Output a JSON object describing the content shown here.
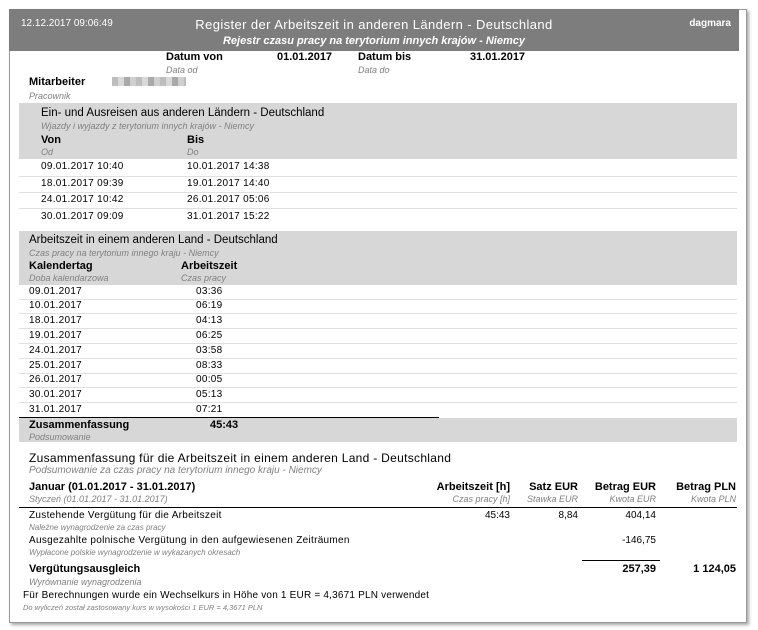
{
  "header": {
    "datetime": "12.12.2017  09:06:49",
    "title_de": "Register der Arbeitszeit in anderen Ländern - Deutschland",
    "title_pl": "Rejestr czasu pracy na terytorium innych krajów - Niemcy",
    "user": "dagmara"
  },
  "period": {
    "from_label": "Datum von",
    "from_label_pl": "Data od",
    "from_value": "01.01.2017",
    "to_label": "Datum bis",
    "to_label_pl": "Data do",
    "to_value": "31.01.2017"
  },
  "employee": {
    "label": "Mitarbeiter",
    "label_pl": "Pracownik"
  },
  "trips": {
    "title": "Ein- und Ausreisen aus anderen Ländern - Deutschland",
    "title_pl": "Wjazdy i wyjazdy z terytorium innych krajów - Niemcy",
    "col_from": "Von",
    "col_from_pl": "Od",
    "col_to": "Bis",
    "col_to_pl": "Do",
    "rows": [
      {
        "from": "09.01.2017  10:40",
        "to": "10.01.2017  14:38"
      },
      {
        "from": "18.01.2017  09:39",
        "to": "19.01.2017  14:40"
      },
      {
        "from": "24.01.2017  10:42",
        "to": "26.01.2017  05:06"
      },
      {
        "from": "30.01.2017  09:09",
        "to": "31.01.2017  15:22"
      }
    ]
  },
  "worktime": {
    "title": "Arbeitszeit in einem anderen Land - Deutschland",
    "title_pl": "Czas pracy na terytorium innego kraju - Niemcy",
    "col_day": "Kalendertag",
    "col_day_pl": "Doba kalendarzowa",
    "col_time": "Arbeitszeit",
    "col_time_pl": "Czas pracy",
    "rows": [
      {
        "day": "09.01.2017",
        "time": "03:36"
      },
      {
        "day": "10.01.2017",
        "time": "06:19"
      },
      {
        "day": "18.01.2017",
        "time": "04:13"
      },
      {
        "day": "19.01.2017",
        "time": "06:25"
      },
      {
        "day": "24.01.2017",
        "time": "03:58"
      },
      {
        "day": "25.01.2017",
        "time": "08:33"
      },
      {
        "day": "26.01.2017",
        "time": "00:05"
      },
      {
        "day": "30.01.2017",
        "time": "05:13"
      },
      {
        "day": "31.01.2017",
        "time": "07:21"
      }
    ],
    "sum_label": "Zusammenfassung",
    "sum_label_pl": "Podsumowanie",
    "sum_value": "45:43"
  },
  "summary": {
    "title": "Zusammenfassung für die Arbeitszeit in einem anderen Land - Deutschland",
    "title_pl": "Podsumowanie za czas pracy na terytorium innego kraju - Niemcy",
    "period_label": "Januar (01.01.2017 - 31.01.2017)",
    "period_label_pl": "Styczeń (01.01.2017 - 31.01.2017)",
    "col_hours": "Arbeitszeit [h]",
    "col_hours_pl": "Czas pracy [h]",
    "col_rate": "Satz EUR",
    "col_rate_pl": "Stawka EUR",
    "col_eur": "Betrag EUR",
    "col_eur_pl": "Kwota EUR",
    "col_pln": "Betrag PLN",
    "col_pln_pl": "Kwota PLN",
    "row1_label": "Zustehende Vergütung für die Arbeitszeit",
    "row1_label_pl": "Należne wynagrodzenie za czas pracy",
    "row1_hours": "45:43",
    "row1_rate": "8,84",
    "row1_eur": "404,14",
    "row2_label": "Ausgezahlte polnische Vergütung in den aufgewiesenen Zeiträumen",
    "row2_label_pl": "Wypłacone polskie wynagrodzenie w wykazanych okresach",
    "row2_eur": "-146,75",
    "total_label": "Vergütungsausgleich",
    "total_label_pl": "Wyrównanie wynagrodzenia",
    "total_eur": "257,39",
    "total_pln": "1 124,05",
    "note": "Für Berechnungen wurde ein Wechselkurs in Höhe von 1 EUR = 4,3671 PLN verwendet",
    "note_pl": "Do wyliczeń został zastosowany kurs w wysokości 1 EUR = 4,3671 PLN"
  }
}
